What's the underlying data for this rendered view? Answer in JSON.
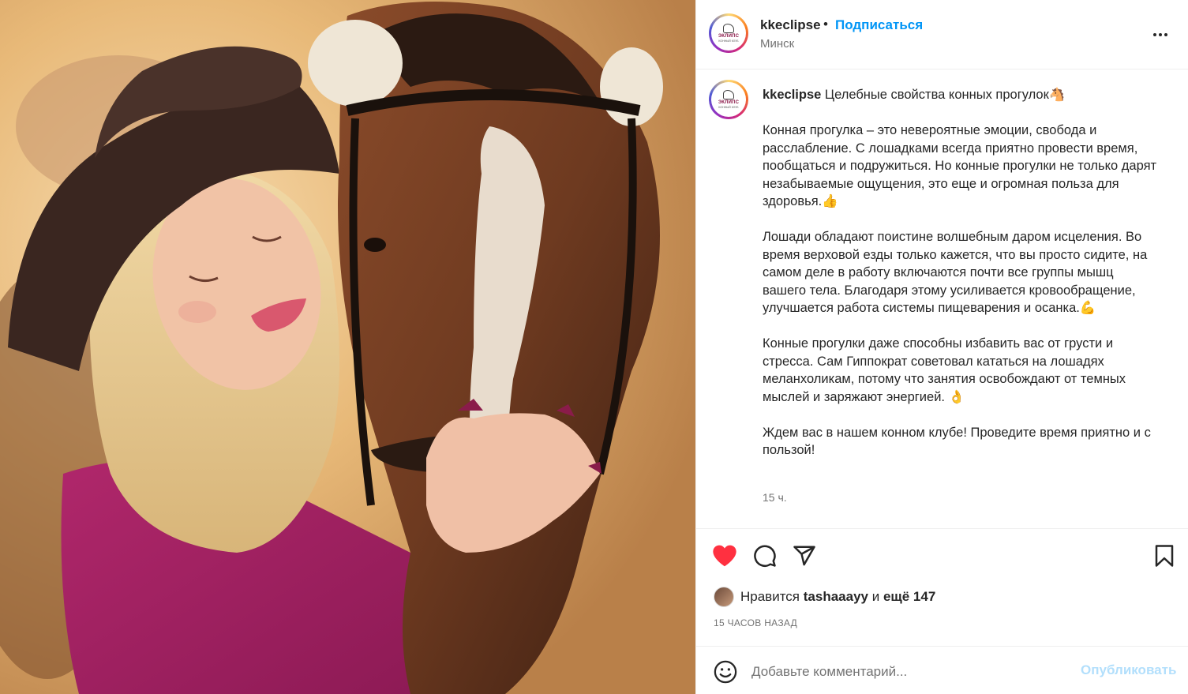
{
  "post": {
    "username": "kkeclipse",
    "separator": "•",
    "follow_label": "Подписаться",
    "location": "Минск",
    "logo": {
      "title": "ЭКЛИПС",
      "subtitle": "КОННЫЙ КЛУБ"
    },
    "photo_alt": "photo"
  },
  "caption": {
    "username": "kkeclipse",
    "first_line": "Целебные свойства конных прогулок🐴",
    "paragraphs": [
      "Конная прогулка – это невероятные эмоции, свобода и расслабление. С лошадками всегда приятно провести время, пообщаться и подружиться. Но конные прогулки не только дарят незабываемые ощущения, это еще и огромная польза для здоровья.👍",
      "Лошади обладают поистине волшебным даром исцеления. Во время верховой езды только кажется, что вы просто сидите, на самом деле в работу включаются почти все группы мышц вашего тела. Благодаря этому усиливается кровообращение, улучшается работа системы пищеварения и осанка.💪",
      "Конные прогулки даже способны избавить вас от грусти и стресса. Сам Гиппократ советовал кататься на лошадях меланхоликам, потому что занятия освобождают от темных мыслей и заряжают энергией. 👌",
      "Ждем вас в нашем конном клубе! Проведите время приятно и с пользой!"
    ],
    "time": "15 ч."
  },
  "likes": {
    "prefix": "Нравится",
    "user": "tashaaayy",
    "conj": "и",
    "more": "ещё 147"
  },
  "date": "15 ЧАСОВ НАЗАД",
  "comment": {
    "placeholder": "Добавьте комментарий...",
    "publish_label": "Опубликовать"
  },
  "colors": {
    "accent": "#0095f6",
    "like": "#ff3040",
    "publish_disabled": "#b2dffc",
    "muted": "#737373"
  },
  "icons": [
    "heart-icon",
    "comment-icon",
    "share-icon",
    "bookmark-icon",
    "emoji-icon",
    "more-icon"
  ]
}
